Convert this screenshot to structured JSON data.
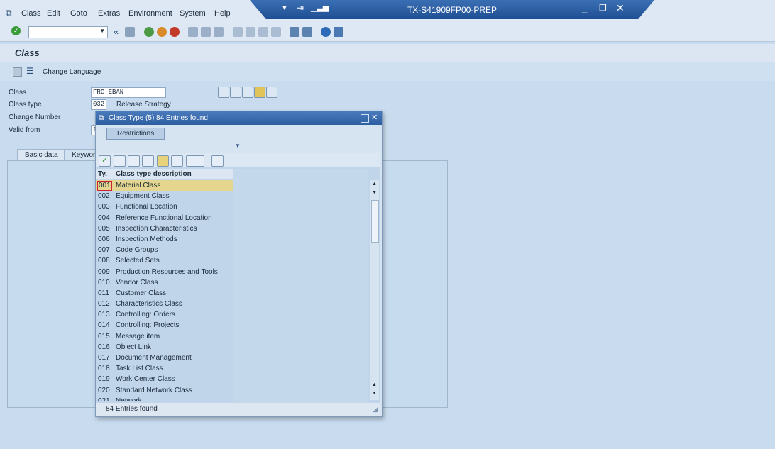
{
  "menu": [
    "Class",
    "Edit",
    "Goto",
    "Extras",
    "Environment",
    "System",
    "Help"
  ],
  "window_title": "TX-S41909FP00-PREP",
  "screen_title": "Class",
  "app_toolbar": {
    "change_language": "Change Language"
  },
  "form": {
    "class_label": "Class",
    "class_value": "FRG_EBAN",
    "class_type_label": "Class type",
    "class_type_value": "032",
    "class_type_desc": "Release Strategy",
    "change_number_label": "Change Number",
    "valid_from_label": "Valid from",
    "valid_from_value": "1"
  },
  "tabs": {
    "basic_data": "Basic data",
    "keywords": "Keywor"
  },
  "popup": {
    "title": "Class Type (5)   84 Entries found",
    "restrictions_tab": "Restrictions",
    "col_ty": "Ty.",
    "col_desc": "Class type description",
    "status": "84 Entries found",
    "rows": [
      {
        "ty": "001",
        "desc": "Material Class"
      },
      {
        "ty": "002",
        "desc": "Equipment Class"
      },
      {
        "ty": "003",
        "desc": "Functional Location"
      },
      {
        "ty": "004",
        "desc": "Reference Functional Location"
      },
      {
        "ty": "005",
        "desc": "Inspection Characteristics"
      },
      {
        "ty": "006",
        "desc": "Inspection Methods"
      },
      {
        "ty": "007",
        "desc": "Code Groups"
      },
      {
        "ty": "008",
        "desc": "Selected Sets"
      },
      {
        "ty": "009",
        "desc": "Production Resources and Tools"
      },
      {
        "ty": "010",
        "desc": "Vendor Class"
      },
      {
        "ty": "011",
        "desc": "Customer Class"
      },
      {
        "ty": "012",
        "desc": "Characteristics Class"
      },
      {
        "ty": "013",
        "desc": "Controlling: Orders"
      },
      {
        "ty": "014",
        "desc": "Controlling: Projects"
      },
      {
        "ty": "015",
        "desc": "Message item"
      },
      {
        "ty": "016",
        "desc": "Object Link"
      },
      {
        "ty": "017",
        "desc": "Document Management"
      },
      {
        "ty": "018",
        "desc": "Task List Class"
      },
      {
        "ty": "019",
        "desc": "Work Center Class"
      },
      {
        "ty": "020",
        "desc": "Standard Network Class"
      },
      {
        "ty": "021",
        "desc": "Network"
      }
    ]
  },
  "colors": {
    "title_bar": "#2d5e9f",
    "selected_row": "#e4d68e",
    "ok_green": "#3a9b3a"
  }
}
